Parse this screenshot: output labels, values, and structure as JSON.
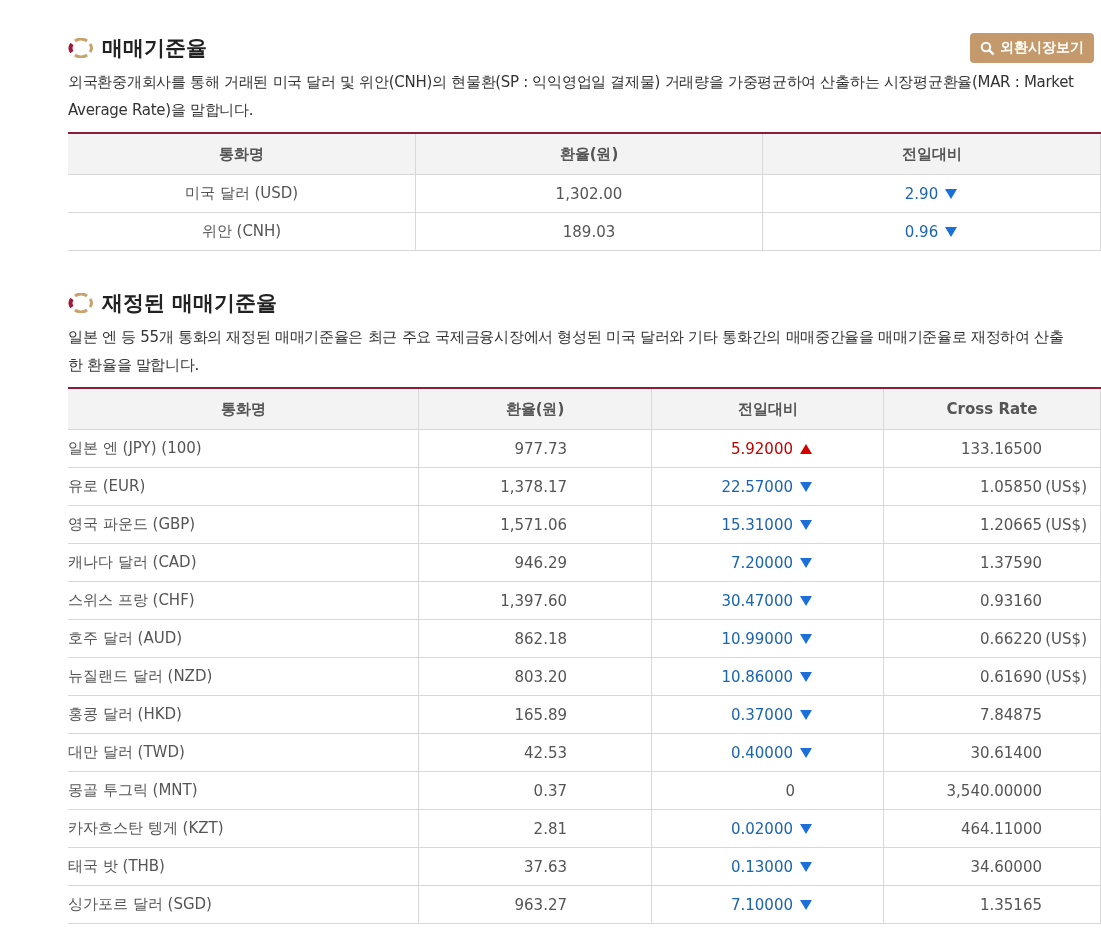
{
  "sections": [
    {
      "title": "매매기준율",
      "button": "외환시장보기",
      "description": "외국환중개회사를 통해 거래된 미국 달러 및 위안(CNH)의 현물환(SP : 익익영업일 결제물) 거래량을 가중평균하여 산출하는 시장평균환율(MAR : Market Average Rate)을 말합니다.",
      "table": {
        "columns": [
          "통화명",
          "환율(원)",
          "전일대비"
        ],
        "rows": [
          {
            "currency": "미국 달러 (USD)",
            "rate": "1,302.00",
            "change": "2.90",
            "kind": "down"
          },
          {
            "currency": "위안 (CNH)",
            "rate": "189.03",
            "change": "0.96",
            "kind": "down"
          }
        ]
      }
    },
    {
      "title": "재정된 매매기준율",
      "description": "일본 엔 등 55개 통화의 재정된 매매기준율은 최근 주요 국제금융시장에서 형성된 미국 달러와 기타 통화간의 매매중간율을 매매기준율로 재정하여 산출한 환율을 말합니다.",
      "table": {
        "columns": [
          "통화명",
          "환율(원)",
          "전일대비",
          "Cross Rate"
        ],
        "rows": [
          {
            "currency": "일본 엔 (JPY) (100)",
            "rate": "977.73",
            "change": "5.92000",
            "kind": "up",
            "cross": "133.16500"
          },
          {
            "currency": "유로 (EUR)",
            "rate": "1,378.17",
            "change": "22.57000",
            "kind": "down",
            "cross": "1.05850",
            "unit": "(US$)"
          },
          {
            "currency": "영국 파운드 (GBP)",
            "rate": "1,571.06",
            "change": "15.31000",
            "kind": "down",
            "cross": "1.20665",
            "unit": "(US$)"
          },
          {
            "currency": "캐나다 달러 (CAD)",
            "rate": "946.29",
            "change": "7.20000",
            "kind": "down",
            "cross": "1.37590"
          },
          {
            "currency": "스위스 프랑 (CHF)",
            "rate": "1,397.60",
            "change": "30.47000",
            "kind": "down",
            "cross": "0.93160"
          },
          {
            "currency": "호주 달러 (AUD)",
            "rate": "862.18",
            "change": "10.99000",
            "kind": "down",
            "cross": "0.66220",
            "unit": "(US$)"
          },
          {
            "currency": "뉴질랜드 달러 (NZD)",
            "rate": "803.20",
            "change": "10.86000",
            "kind": "down",
            "cross": "0.61690",
            "unit": "(US$)"
          },
          {
            "currency": "홍콩 달러 (HKD)",
            "rate": "165.89",
            "change": "0.37000",
            "kind": "down",
            "cross": "7.84875"
          },
          {
            "currency": "대만 달러 (TWD)",
            "rate": "42.53",
            "change": "0.40000",
            "kind": "down",
            "cross": "30.61400"
          },
          {
            "currency": "몽골 투그릭 (MNT)",
            "rate": "0.37",
            "change": "0",
            "kind": "flat",
            "cross": "3,540.00000"
          },
          {
            "currency": "카자흐스탄 텡게 (KZT)",
            "rate": "2.81",
            "change": "0.02000",
            "kind": "down",
            "cross": "464.11000"
          },
          {
            "currency": "태국 밧 (THB)",
            "rate": "37.63",
            "change": "0.13000",
            "kind": "down",
            "cross": "34.60000"
          },
          {
            "currency": "싱가포르 달러 (SGD)",
            "rate": "963.27",
            "change": "7.10000",
            "kind": "down",
            "cross": "1.35165"
          }
        ]
      }
    }
  ]
}
